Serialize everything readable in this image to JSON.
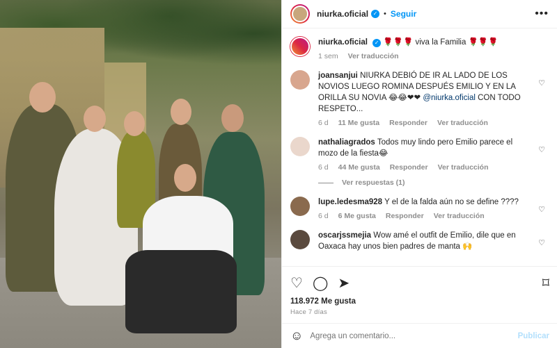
{
  "header": {
    "username": "niurka.oficial",
    "separator": "•",
    "follow_label": "Seguir",
    "more_icon": "more-horizontal-icon"
  },
  "caption": {
    "username": "niurka.oficial",
    "text": "🌹🌹🌹 viva la Familia 🌹🌹🌹",
    "time": "1 sem",
    "translate": "Ver traducción"
  },
  "comments": [
    {
      "username": "joansanjui",
      "text": "NIURKA DEBIÓ DE IR AL LADO DE LOS NOVIOS LUEGO ROMINA DESPUÉS EMILIO Y EN LA ORILLA SU NOVIA 😂😂❤❤ ",
      "mention": "@niurka.oficial",
      "text_after": " CON TODO RESPETO...",
      "time": "6 d",
      "likes": "11 Me gusta",
      "reply": "Responder",
      "translate": "Ver traducción"
    },
    {
      "username": "nathaliagrados",
      "text": "Todos muy lindo pero Emilio parece el mozo de la fiesta😂",
      "time": "6 d",
      "likes": "44 Me gusta",
      "reply": "Responder",
      "translate": "Ver traducción",
      "view_replies": "Ver respuestas (1)"
    },
    {
      "username": "lupe.ledesma928",
      "text": "Y el de la falda aún no se define ????",
      "time": "6 d",
      "likes": "6 Me gusta",
      "reply": "Responder",
      "translate": "Ver traducción"
    },
    {
      "username": "oscarjssmejia",
      "text": "Wow amé el outfit de Emilio, dile que en Oaxaca hay unos bien padres de manta 🙌"
    }
  ],
  "actions": {
    "like_icon": "heart-icon",
    "comment_icon": "comment-icon",
    "share_icon": "send-icon",
    "save_icon": "bookmark-icon",
    "likes_count": "118.972 Me gusta",
    "date": "Hace 7 días"
  },
  "composer": {
    "emoji_icon": "emoji-icon",
    "placeholder": "Agrega un comentario...",
    "post_label": "Publicar"
  },
  "colors": {
    "accent": "#0095f6",
    "muted": "#8e8e8e",
    "post_disabled": "#b2dffc"
  }
}
